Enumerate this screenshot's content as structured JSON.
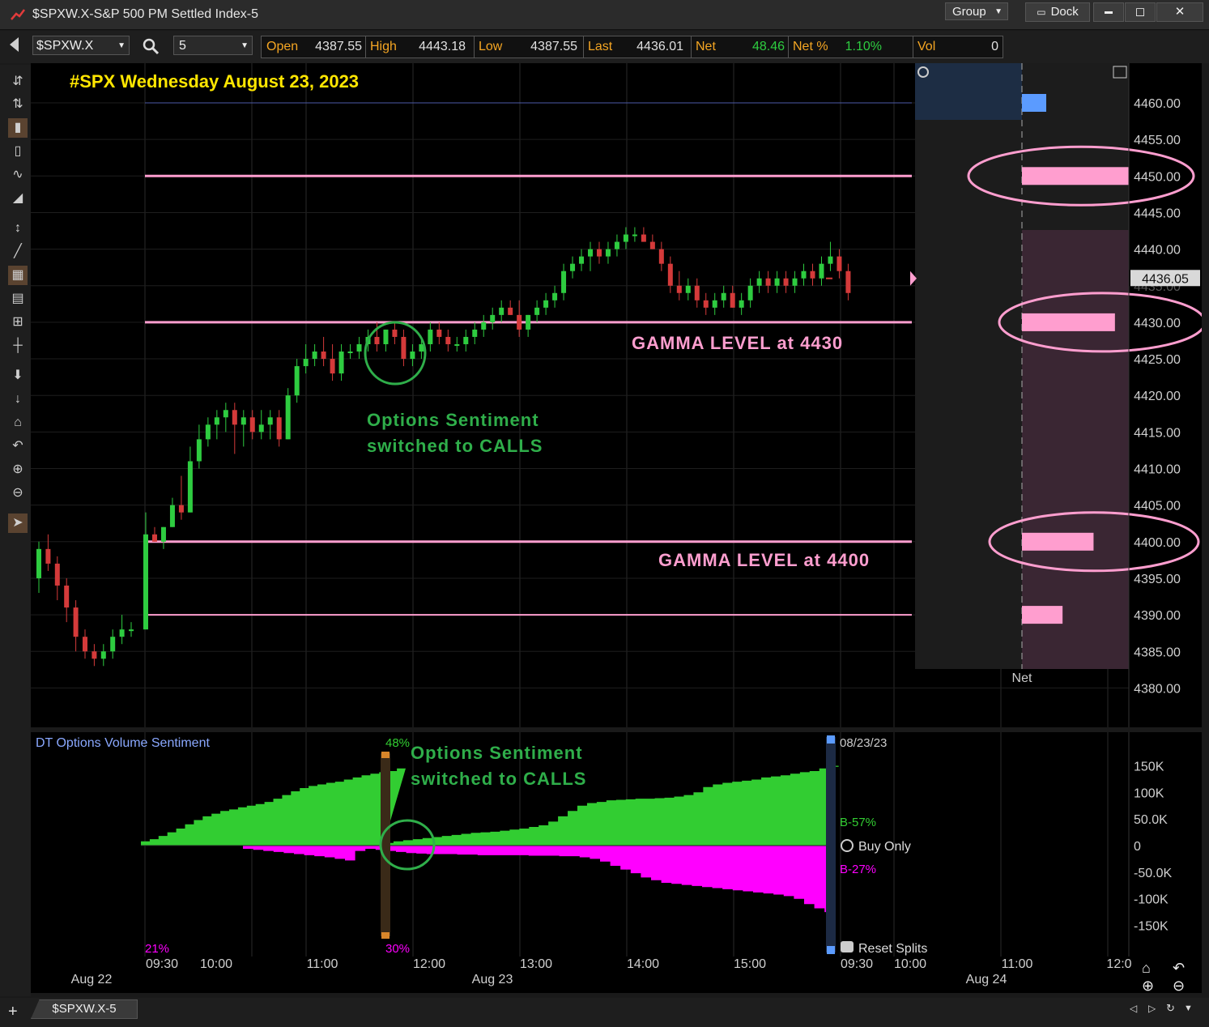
{
  "window": {
    "title": "$SPXW.X-S&P 500 PM Settled Index-5",
    "group_label": "Group",
    "dock_label": "Dock",
    "minimize_glyph": "▬",
    "maximize_glyph": "◻",
    "close_glyph": "✕"
  },
  "toolbar": {
    "symbol": "$SPXW.X",
    "interval": "5",
    "quote": [
      {
        "label": "Open",
        "value": "4387.55"
      },
      {
        "label": "High",
        "value": "4443.18"
      },
      {
        "label": "Low",
        "value": "4387.55"
      },
      {
        "label": "Last",
        "value": "4436.01"
      },
      {
        "label": "Net",
        "value": "48.46"
      },
      {
        "label": "Net %",
        "value": "1.10%"
      },
      {
        "label": "Vol",
        "value": "0"
      }
    ],
    "net_color": "#2ecc40"
  },
  "annotations": {
    "headline": "#SPX Wednesday August 23, 2023",
    "gamma_4430": "GAMMA LEVEL at 4430",
    "gamma_4400": "GAMMA LEVEL at 4400",
    "sentiment_line1": "Options Sentiment",
    "sentiment_line2": "switched to CALLS",
    "vol_sentiment_line1": "Options Sentiment",
    "vol_sentiment_line2": "switched to CALLS"
  },
  "price_axis": {
    "labels": [
      "4460.00",
      "4455.00",
      "4450.00",
      "4445.00",
      "4440.00",
      "4430.00",
      "4425.00",
      "4420.00",
      "4415.00",
      "4410.00",
      "4405.00",
      "4400.00",
      "4395.00",
      "4390.00",
      "4385.00",
      "4380.00"
    ],
    "last_price_tag": "4436.05",
    "hidden_tick": "4435.00",
    "net_label": "Net"
  },
  "volume_panel": {
    "title": "DT Options Volume Sentiment",
    "date_label": "08/23/23",
    "y_labels": [
      "150K",
      "100K",
      "50.0K",
      "0",
      "-50.0K",
      "-100K",
      "-150K"
    ],
    "buy_pct_top": "48%",
    "buy_pct_bottom": "30%",
    "left_pct": "21%",
    "b_green": "B-57%",
    "b_magenta": "B-27%",
    "buy_only": "Buy Only",
    "reset_splits": "Reset Splits"
  },
  "time_axis": {
    "times": [
      "09:30",
      "10:00",
      "11:00",
      "12:00",
      "13:00",
      "14:00",
      "15:00",
      "09:30",
      "10:00",
      "11:00",
      "12:0"
    ],
    "dates": [
      "Aug 22",
      "Aug 23",
      "Aug 24"
    ]
  },
  "bottom_tab": "$SPXW.X-5",
  "colors": {
    "up": "#2ecc40",
    "down": "#d43a3a",
    "gamma": "#ff9ecf",
    "sentiment_green": "#2fae4a",
    "headline": "#ffe600",
    "magenta": "#ff00ff"
  },
  "chart_data": {
    "type": "candlestick",
    "price_range": [
      4377,
      4465
    ],
    "gamma_levels": [
      4450,
      4430,
      4400,
      4390
    ],
    "net_bars": [
      {
        "price": 4460,
        "relative": 0.25,
        "color": "#5b9bff"
      },
      {
        "price": 4450,
        "relative": 1.0
      },
      {
        "price": 4430,
        "relative": 0.87
      },
      {
        "price": 4400,
        "relative": 0.67
      },
      {
        "price": 4390,
        "relative": 0.38
      }
    ],
    "candles_prev_day": [
      [
        4395,
        4400,
        4393,
        4399
      ],
      [
        4399,
        4401,
        4396,
        4397
      ],
      [
        4397,
        4398,
        4392,
        4394
      ],
      [
        4394,
        4395,
        4389,
        4391
      ],
      [
        4391,
        4392,
        4385,
        4387
      ],
      [
        4387,
        4388,
        4384,
        4385
      ],
      [
        4385,
        4386,
        4383,
        4384
      ],
      [
        4384,
        4386,
        4383,
        4385
      ],
      [
        4385,
        4388,
        4384,
        4387
      ],
      [
        4387,
        4390,
        4386,
        4388
      ],
      [
        4388,
        4389,
        4387,
        4388
      ]
    ],
    "candles": [
      [
        4388,
        4404,
        4388,
        4401
      ],
      [
        4401,
        4402,
        4400,
        4400
      ],
      [
        4400,
        4402,
        4399,
        4402
      ],
      [
        4402,
        4406,
        4402,
        4405
      ],
      [
        4405,
        4409,
        4403,
        4404
      ],
      [
        4404,
        4413,
        4404,
        4411
      ],
      [
        4411,
        4416,
        4410,
        4414
      ],
      [
        4414,
        4417,
        4413,
        4416
      ],
      [
        4416,
        4418,
        4414,
        4417
      ],
      [
        4417,
        4419,
        4415,
        4418
      ],
      [
        4418,
        4419,
        4412,
        4416
      ],
      [
        4416,
        4418,
        4413,
        4417
      ],
      [
        4417,
        4418,
        4414,
        4415
      ],
      [
        4415,
        4418,
        4414,
        4416
      ],
      [
        4416,
        4418,
        4414,
        4417
      ],
      [
        4417,
        4418,
        4413,
        4414
      ],
      [
        4414,
        4421,
        4414,
        4420
      ],
      [
        4420,
        4425,
        4419,
        4424
      ],
      [
        4424,
        4427,
        4423,
        4425
      ],
      [
        4425,
        4427,
        4424,
        4426
      ],
      [
        4426,
        4428,
        4424,
        4425
      ],
      [
        4425,
        4427,
        4422,
        4423
      ],
      [
        4423,
        4427,
        4422,
        4426
      ],
      [
        4426,
        4427,
        4425,
        4426
      ],
      [
        4426,
        4428,
        4425,
        4427
      ],
      [
        4427,
        4429,
        4426,
        4428
      ],
      [
        4428,
        4430,
        4426,
        4427
      ],
      [
        4427,
        4429,
        4426,
        4429
      ],
      [
        4429,
        4430,
        4427,
        4428
      ],
      [
        4428,
        4429,
        4424,
        4425
      ],
      [
        4425,
        4427,
        4424,
        4426
      ],
      [
        4426,
        4428,
        4425,
        4427
      ],
      [
        4427,
        4430,
        4426,
        4429
      ],
      [
        4429,
        4430,
        4427,
        4428
      ],
      [
        4428,
        4429,
        4426,
        4427
      ],
      [
        4427,
        4428,
        4426,
        4427
      ],
      [
        4427,
        4429,
        4426,
        4428
      ],
      [
        4428,
        4430,
        4427,
        4429
      ],
      [
        4429,
        4431,
        4428,
        4430
      ],
      [
        4430,
        4432,
        4429,
        4431
      ],
      [
        4431,
        4433,
        4430,
        4432
      ],
      [
        4432,
        4433,
        4431,
        4431
      ],
      [
        4431,
        4433,
        4428,
        4429
      ],
      [
        4429,
        4431,
        4428,
        4431
      ],
      [
        4431,
        4433,
        4430,
        4432
      ],
      [
        4432,
        4434,
        4431,
        4433
      ],
      [
        4433,
        4435,
        4432,
        4434
      ],
      [
        4434,
        4438,
        4433,
        4437
      ],
      [
        4437,
        4439,
        4436,
        4438
      ],
      [
        4438,
        4440,
        4437,
        4439
      ],
      [
        4439,
        4441,
        4437,
        4440
      ],
      [
        4440,
        4441,
        4438,
        4439
      ],
      [
        4439,
        4441,
        4438,
        4440
      ],
      [
        4440,
        4442,
        4439,
        4441
      ],
      [
        4441,
        4443,
        4440,
        4442
      ],
      [
        4442,
        4443,
        4441,
        4442
      ],
      [
        4442,
        4443,
        4441,
        4441
      ],
      [
        4441,
        4442,
        4440,
        4440
      ],
      [
        4440,
        4441,
        4437,
        4438
      ],
      [
        4438,
        4439,
        4434,
        4435
      ],
      [
        4435,
        4437,
        4433,
        4434
      ],
      [
        4434,
        4436,
        4433,
        4435
      ],
      [
        4435,
        4436,
        4432,
        4433
      ],
      [
        4433,
        4434,
        4431,
        4432
      ],
      [
        4432,
        4434,
        4431,
        4433
      ],
      [
        4433,
        4435,
        4432,
        4434
      ],
      [
        4434,
        4435,
        4432,
        4432
      ],
      [
        4432,
        4434,
        4431,
        4433
      ],
      [
        4433,
        4436,
        4432,
        4435
      ],
      [
        4435,
        4437,
        4434,
        4436
      ],
      [
        4436,
        4437,
        4434,
        4435
      ],
      [
        4435,
        4437,
        4434,
        4436
      ],
      [
        4436,
        4437,
        4434,
        4435
      ],
      [
        4435,
        4437,
        4434,
        4436
      ],
      [
        4436,
        4438,
        4435,
        4437
      ],
      [
        4437,
        4438,
        4435,
        4436
      ],
      [
        4436,
        4439,
        4435,
        4438
      ],
      [
        4438,
        4441,
        4437,
        4439
      ],
      [
        4439,
        4440,
        4436,
        4437
      ],
      [
        4437,
        4438,
        4433,
        4434
      ]
    ],
    "last_tick": 4436,
    "volume_panel": {
      "y_range": [
        -180000,
        180000
      ],
      "calls": [
        8000,
        12000,
        18000,
        25000,
        32000,
        40000,
        48000,
        55000,
        60000,
        65000,
        68000,
        72000,
        75000,
        78000,
        82000,
        88000,
        95000,
        102000,
        108000,
        112000,
        115000,
        118000,
        120000,
        124000,
        128000,
        132000,
        135000,
        138000,
        140000,
        145000,
        5000,
        8000,
        10000,
        12000,
        14000,
        16000,
        18000,
        20000,
        22000,
        24000,
        25000,
        26000,
        28000,
        30000,
        32000,
        35000,
        38000,
        45000,
        55000,
        65000,
        75000,
        80000,
        82000,
        85000,
        86000,
        87000,
        88000,
        88000,
        89000,
        90000,
        92000,
        95000,
        100000,
        110000,
        115000,
        118000,
        120000,
        122000,
        124000,
        128000,
        130000,
        132000,
        135000,
        138000,
        140000,
        145000,
        148000,
        150000
      ],
      "puts": [
        0,
        0,
        0,
        0,
        0,
        0,
        0,
        0,
        0,
        0,
        -6000,
        -8000,
        -10000,
        -12000,
        -14000,
        -16000,
        -18000,
        -20000,
        -22000,
        -25000,
        -28000,
        -10000,
        -6000,
        -8000,
        -10000,
        -12000,
        -14000,
        -15000,
        -16000,
        -16000,
        -16000,
        -17000,
        -17000,
        -18000,
        -18000,
        -18000,
        -18000,
        -18000,
        -19000,
        -19000,
        -19000,
        -20000,
        -20000,
        -22000,
        -25000,
        -30000,
        -38000,
        -45000,
        -52000,
        -60000,
        -65000,
        -70000,
        -72000,
        -74000,
        -76000,
        -78000,
        -80000,
        -82000,
        -84000,
        -86000,
        -88000,
        -90000,
        -92000,
        -95000,
        -100000,
        -110000,
        -118000,
        -125000
      ]
    }
  }
}
